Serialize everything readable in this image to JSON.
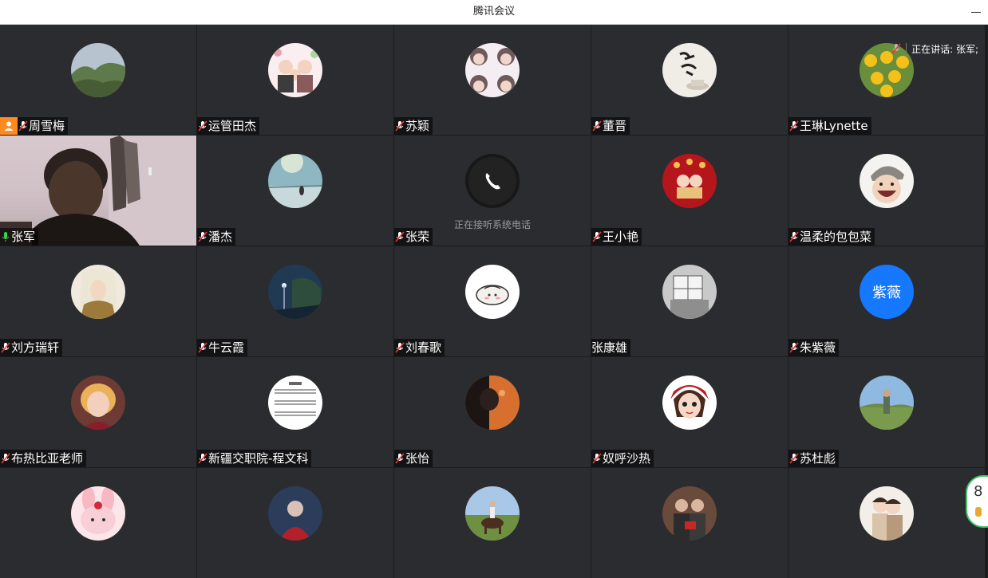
{
  "window": {
    "title": "腾讯会议"
  },
  "speaking_indicator": {
    "text": "正在讲话: 张军;"
  },
  "phone_call_caption": "正在接听系统电话",
  "right_widget": {
    "value": "8"
  },
  "colors": {
    "active_speaker_border": "#2fb85e",
    "host_badge": "#ff8a1f",
    "text_avatar_bg": "#1677ff"
  },
  "participants": [
    {
      "name": "周雪梅",
      "host": true,
      "mic": "muted",
      "avatar": "landscape-hills"
    },
    {
      "name": "运管田杰",
      "mic": "muted",
      "avatar": "cartoon-family"
    },
    {
      "name": "苏颖",
      "mic": "muted",
      "avatar": "four-kids-collage"
    },
    {
      "name": "董晋",
      "mic": "muted",
      "avatar": "calligraphy-tea"
    },
    {
      "name": "王琳Lynette",
      "mic": "muted",
      "avatar": "sunflowers"
    },
    {
      "name": "张军",
      "mic": "on",
      "video": true,
      "avatar": "camera-feed"
    },
    {
      "name": "潘杰",
      "mic": "muted",
      "avatar": "lake-sky"
    },
    {
      "name": "张荣",
      "mic": "muted",
      "avatar": "phone-call"
    },
    {
      "name": "王小艳",
      "mic": "muted",
      "avatar": "red-festive-cartoon"
    },
    {
      "name": "温柔的包包菜",
      "mic": "muted",
      "avatar": "laughing-cartoon"
    },
    {
      "name": "刘方瑞轩",
      "mic": "muted",
      "avatar": "anime-character"
    },
    {
      "name": "牛云霞",
      "mic": "muted",
      "avatar": "night-street"
    },
    {
      "name": "刘春歌",
      "mic": "muted",
      "avatar": "white-cartoon-pig"
    },
    {
      "name": "张康雄",
      "mic": "none",
      "avatar": "window-photo"
    },
    {
      "name": "朱紫薇",
      "mic": "muted",
      "avatar": "text",
      "avatar_text": "紫薇"
    },
    {
      "name": "布热比亚老师",
      "mic": "muted",
      "avatar": "woman-portrait"
    },
    {
      "name": "新疆交职院-程文科",
      "mic": "muted",
      "avatar": "sheet-music"
    },
    {
      "name": "张怡",
      "mic": "muted",
      "avatar": "dark-sunset-portrait"
    },
    {
      "name": "奴呼沙热",
      "mic": "muted",
      "avatar": "cartoon-girl"
    },
    {
      "name": "苏杜彪",
      "mic": "muted",
      "avatar": "man-outdoors"
    },
    {
      "name": "",
      "mic": "none",
      "avatar": "pink-bunny"
    },
    {
      "name": "",
      "mic": "none",
      "avatar": "person-red-coat"
    },
    {
      "name": "",
      "mic": "none",
      "avatar": "horse-rider"
    },
    {
      "name": "",
      "mic": "none",
      "avatar": "couple-photo"
    },
    {
      "name": "",
      "mic": "none",
      "avatar": "cartoon-couple"
    }
  ]
}
